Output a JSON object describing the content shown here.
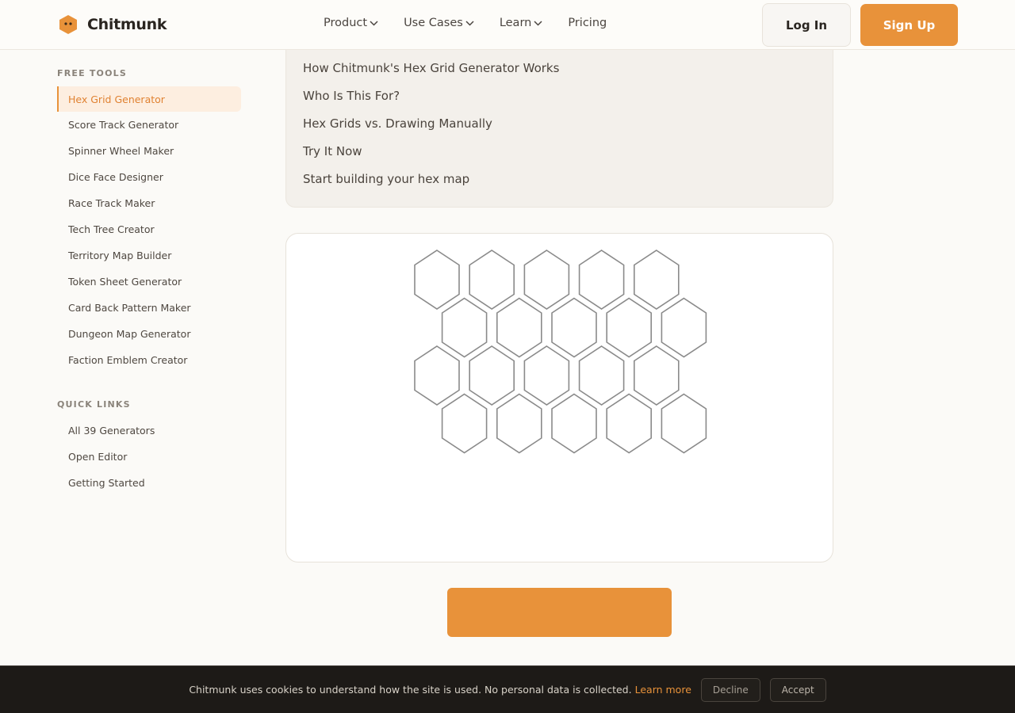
{
  "header": {
    "brand": "Chitmunk",
    "logo_icon": "hexagon-logo-icon",
    "nav": [
      {
        "label": "Product",
        "has_dropdown": true
      },
      {
        "label": "Use Cases",
        "has_dropdown": true
      },
      {
        "label": "Learn",
        "has_dropdown": true
      },
      {
        "label": "Pricing",
        "has_dropdown": false
      }
    ],
    "login_label": "Log In",
    "signup_label": "Sign Up"
  },
  "sidebar": {
    "free_tools_heading": "FREE TOOLS",
    "free_tools": [
      {
        "label": "Hex Grid Generator",
        "active": true
      },
      {
        "label": "Score Track Generator"
      },
      {
        "label": "Spinner Wheel Maker"
      },
      {
        "label": "Dice Face Designer"
      },
      {
        "label": "Race Track Maker"
      },
      {
        "label": "Tech Tree Creator"
      },
      {
        "label": "Territory Map Builder"
      },
      {
        "label": "Token Sheet Generator"
      },
      {
        "label": "Card Back Pattern Maker"
      },
      {
        "label": "Dungeon Map Generator"
      },
      {
        "label": "Faction Emblem Creator"
      }
    ],
    "quick_links_heading": "QUICK LINKS",
    "quick_links": [
      {
        "label": "All 39 Generators"
      },
      {
        "label": "Open Editor"
      },
      {
        "label": "Getting Started"
      }
    ]
  },
  "toc": {
    "items": [
      "How Chitmunk's Hex Grid Generator Works",
      "Who Is This For?",
      "Hex Grids vs. Drawing Manually",
      "Try It Now",
      "Start building your hex map"
    ]
  },
  "hex_grid": {
    "rows": 4,
    "columns": 5,
    "stroke_color": "#8a8a8a"
  },
  "cta": {
    "label": ""
  },
  "cookie_banner": {
    "text": "Chitmunk uses cookies to understand how the site is used. No personal data is collected.",
    "learn_more": "Learn more",
    "decline": "Decline",
    "accept": "Accept"
  },
  "colors": {
    "accent": "#e8923a",
    "background": "#fbfaf7",
    "cookie_bg": "#1d1a17"
  }
}
